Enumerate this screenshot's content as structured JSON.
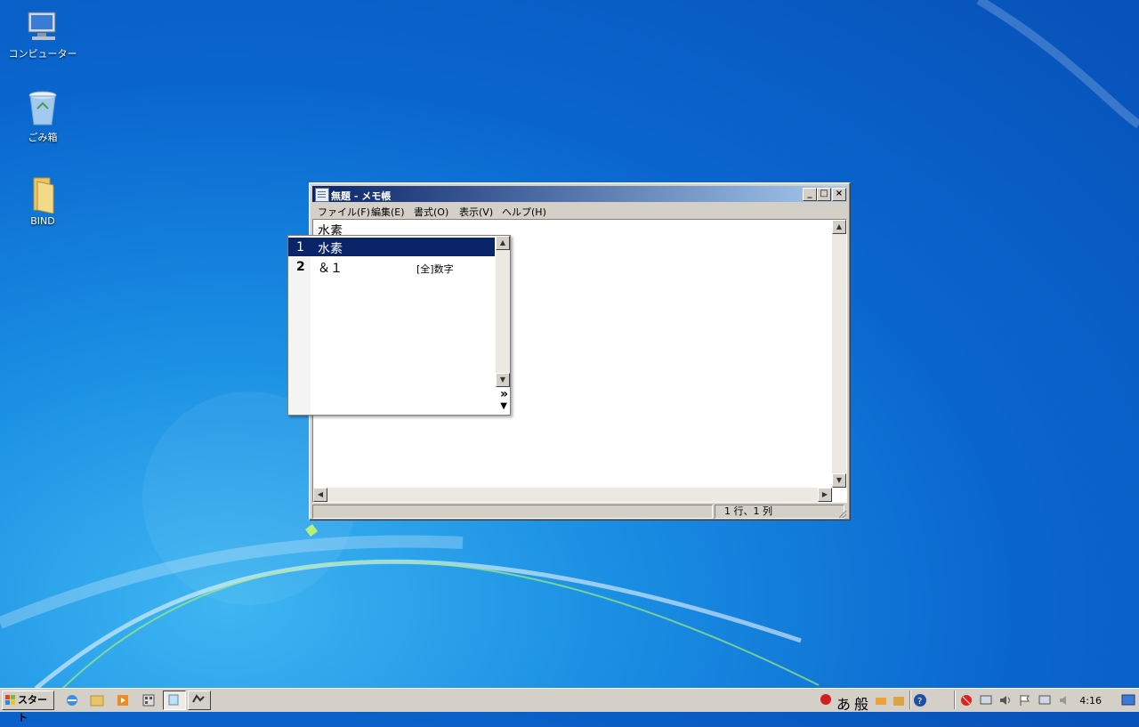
{
  "desktop": {
    "icons": [
      {
        "label": "コンピューター",
        "icon": "computer-icon"
      },
      {
        "label": "ごみ箱",
        "icon": "recycle-bin-icon"
      },
      {
        "label": "BIND",
        "icon": "folder-icon"
      }
    ]
  },
  "notepad": {
    "title": "無題 - メモ帳",
    "menu": [
      "ファイル(F)",
      "編集(E)",
      "書式(O)",
      "表示(V)",
      "ヘルプ(H)"
    ],
    "text": "水素",
    "status_position": "1 行、1 列"
  },
  "ime_candidates": {
    "items": [
      {
        "num": "1",
        "text": "水素",
        "note": "",
        "selected": true
      },
      {
        "num": "2",
        "text": "＆１",
        "note": "[全]数字",
        "selected": false
      }
    ],
    "more_symbol": "»"
  },
  "taskbar": {
    "start_label": "スタート",
    "ime_mode": "あ",
    "ime_dict": "般",
    "clock": "4:16"
  },
  "colors": {
    "title_active": "#0a246a",
    "selection": "#0a246a",
    "desktop": "#0a67cf"
  }
}
